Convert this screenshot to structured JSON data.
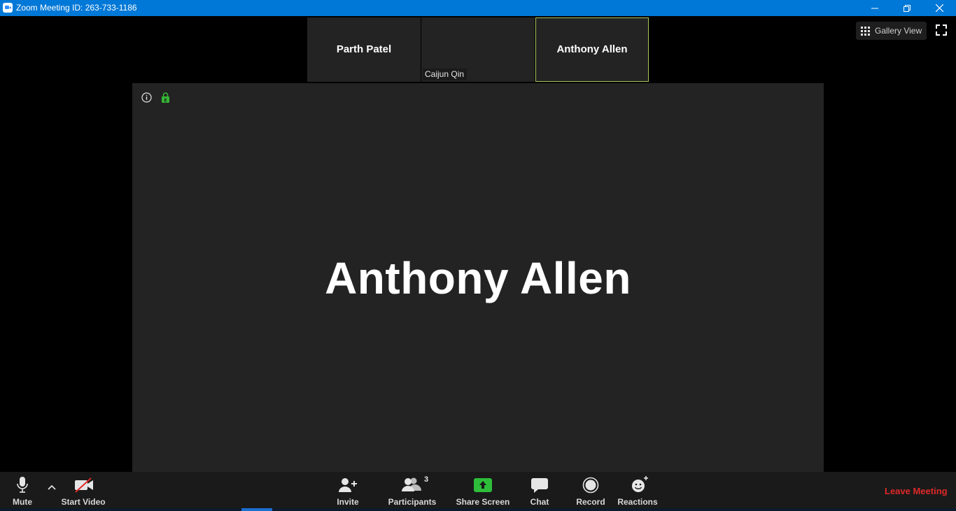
{
  "window": {
    "title": "Zoom Meeting ID: 263-733-1186"
  },
  "thumbnails": [
    {
      "name": "Parth Patel",
      "style": "center"
    },
    {
      "name": "Caijun Qin",
      "style": "tag"
    },
    {
      "name": "Anthony Allen",
      "style": "center",
      "active": true
    }
  ],
  "view": {
    "gallery_label": "Gallery View"
  },
  "main": {
    "speaker_name": "Anthony Allen"
  },
  "toolbar": {
    "mute_label": "Mute",
    "start_video_label": "Start Video",
    "invite_label": "Invite",
    "participants_label": "Participants",
    "participants_count": "3",
    "share_screen_label": "Share Screen",
    "chat_label": "Chat",
    "record_label": "Record",
    "reactions_label": "Reactions",
    "leave_label": "Leave Meeting"
  },
  "colors": {
    "titlebar": "#0078d7",
    "share_green": "#2dbd3a",
    "leave_red": "#e02828",
    "active_border": "#a8c95a",
    "lock_green": "#35b533"
  }
}
